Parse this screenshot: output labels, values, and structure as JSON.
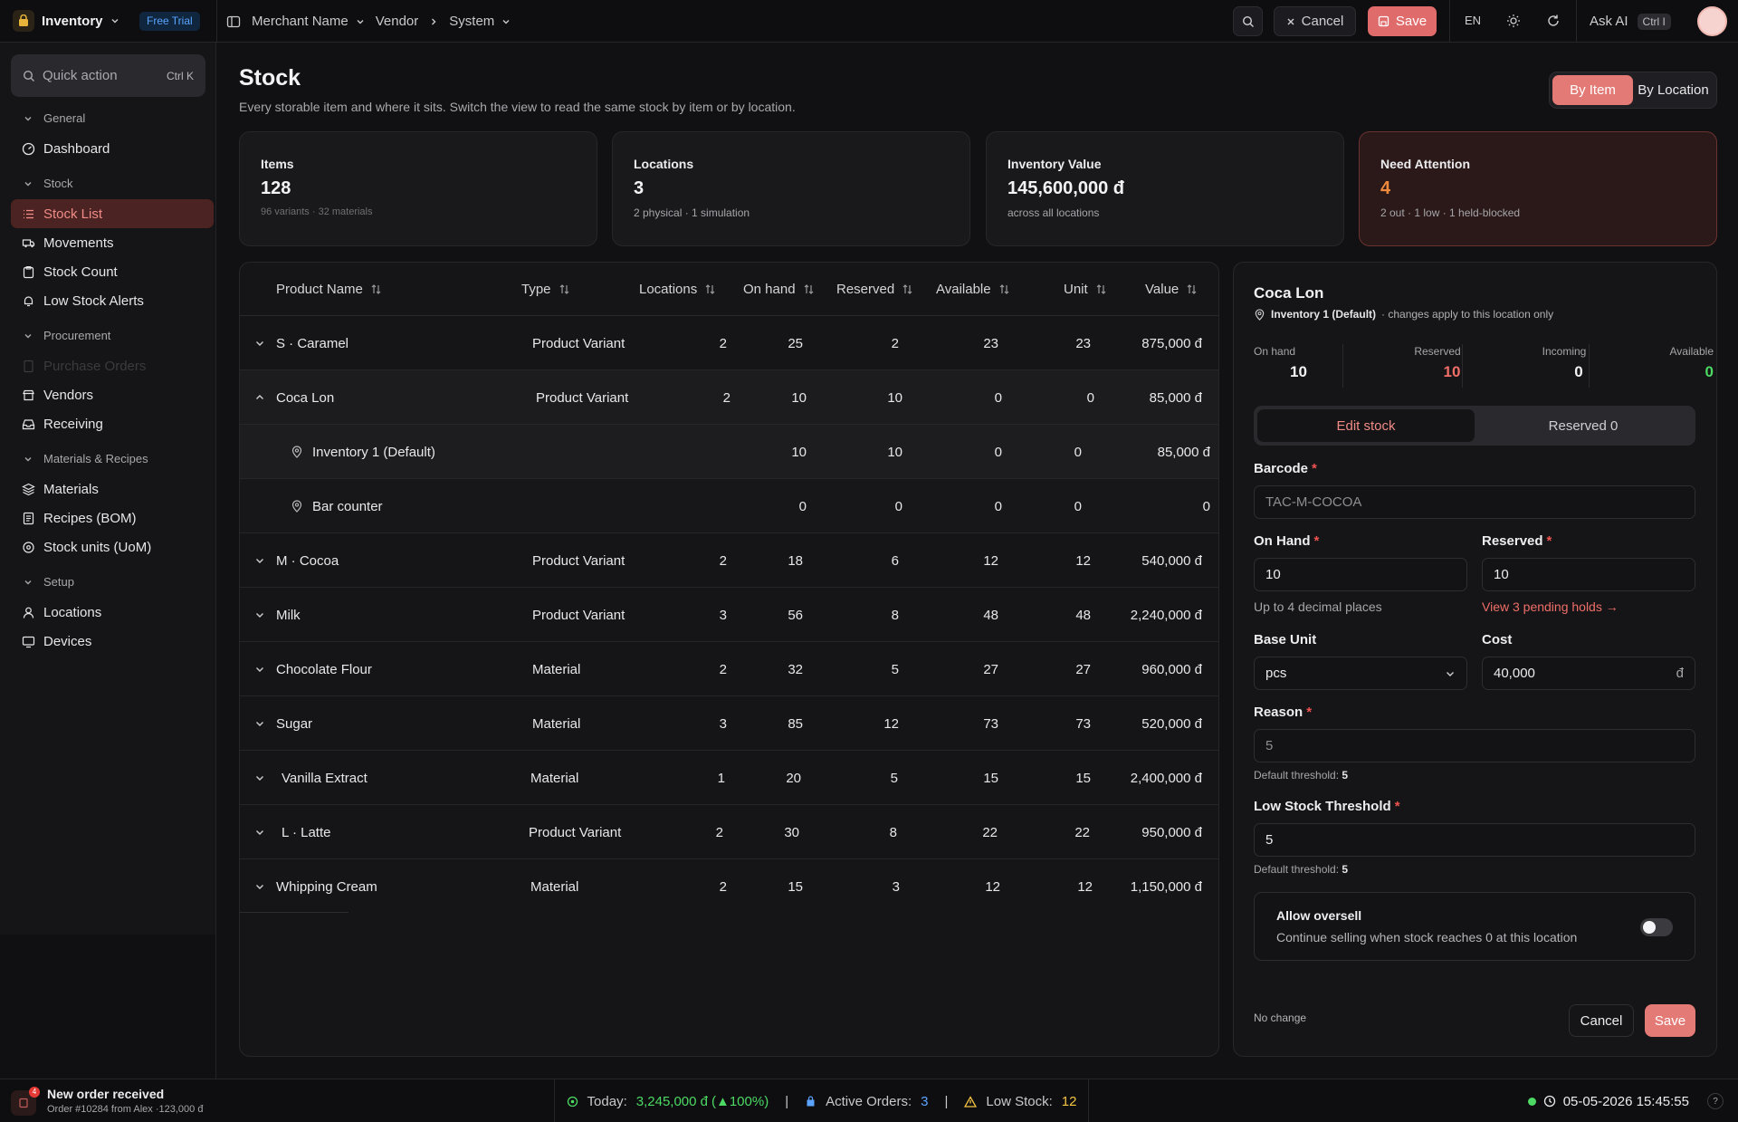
{
  "app": {
    "name": "Inventory",
    "badge": "Free Trial"
  },
  "breadcrumbs": [
    "Merchant Name",
    "Vendor",
    "System"
  ],
  "topbar": {
    "cancel": "Cancel",
    "save": "Save",
    "lang": "EN",
    "ask_ai": "Ask AI",
    "ask_ai_shortcut": "Ctrl I"
  },
  "sidebar": {
    "quick_action": "Quick action",
    "quick_shortcut": "Ctrl K",
    "sections": {
      "general": "General",
      "stock": "Stock",
      "procurement": "Procurement",
      "materials": "Materials & Recipes",
      "setup": "Setup"
    },
    "items": {
      "dashboard": "Dashboard",
      "stock_list": "Stock List",
      "movements": "Movements",
      "stock_count": "Stock Count",
      "low_stock_alerts": "Low Stock Alerts",
      "purchase_orders": "Purchase Orders",
      "vendors": "Vendors",
      "receiving": "Receiving",
      "materials": "Materials",
      "recipes": "Recipes (BOM)",
      "stock_units": "Stock units (UoM)",
      "locations": "Locations",
      "devices": "Devices"
    }
  },
  "page": {
    "title": "Stock",
    "subtitle": "Every storable item and where it sits. Switch the view to read the same stock by item or by location.",
    "view_toggle": [
      "By Item",
      "By Location"
    ],
    "active_view": "By Item"
  },
  "cards": [
    {
      "label": "Items",
      "value": "128",
      "note": "96 variants · 32 materials"
    },
    {
      "label": "Locations",
      "value": "3",
      "note": "2 physical · 1 simulation"
    },
    {
      "label": "Inventory Value",
      "value": "145,600,000 đ",
      "note": "across all locations"
    },
    {
      "label": "Need Attention",
      "value": "4",
      "note": "2 out · 1 low · 1 held-blocked"
    }
  ],
  "table": {
    "columns": [
      "Product Name",
      "Type",
      "Locations",
      "On hand",
      "Reserved",
      "Available",
      "Unit",
      "Value"
    ],
    "rows": [
      {
        "name": "S · Caramel",
        "type": "Product Variant",
        "locations": "2",
        "on_hand": "25",
        "reserved": "2",
        "available": "23",
        "unit": "23",
        "value": "875,000 đ"
      },
      {
        "name": "Coca Lon",
        "type": "Product Variant",
        "locations": "2",
        "on_hand": "10",
        "reserved": "10",
        "available": "0",
        "unit": "0",
        "value": "85,000 đ"
      },
      {
        "name": "M · Cocoa",
        "type": "Product Variant",
        "locations": "2",
        "on_hand": "18",
        "reserved": "6",
        "available": "12",
        "unit": "12",
        "value": "540,000 đ"
      },
      {
        "name": "Milk",
        "type": "Product Variant",
        "locations": "3",
        "on_hand": "56",
        "reserved": "8",
        "available": "48",
        "unit": "48",
        "value": "2,240,000 đ"
      },
      {
        "name": "Chocolate Flour",
        "type": "Material",
        "locations": "2",
        "on_hand": "32",
        "reserved": "5",
        "available": "27",
        "unit": "27",
        "value": "960,000 đ"
      },
      {
        "name": "Sugar",
        "type": "Material",
        "locations": "3",
        "on_hand": "85",
        "reserved": "12",
        "available": "73",
        "unit": "73",
        "value": "520,000 đ"
      },
      {
        "name": "Vanilla Extract",
        "type": "Material",
        "locations": "1",
        "on_hand": "20",
        "reserved": "5",
        "available": "15",
        "unit": "15",
        "value": "2,400,000 đ"
      },
      {
        "name": "L · Latte",
        "type": "Product Variant",
        "locations": "2",
        "on_hand": "30",
        "reserved": "8",
        "available": "22",
        "unit": "22",
        "value": "950,000 đ"
      },
      {
        "name": "Whipping Cream",
        "type": "Material",
        "locations": "2",
        "on_hand": "15",
        "reserved": "3",
        "available": "12",
        "unit": "12",
        "value": "1,150,000 đ"
      }
    ],
    "sub_rows": [
      {
        "name": "Inventory 1 (Default)",
        "on_hand": "10",
        "reserved": "10",
        "available": "0",
        "unit": "0",
        "value": "85,000 đ"
      },
      {
        "name": "Bar counter",
        "on_hand": "0",
        "reserved": "0",
        "available": "0",
        "unit": "0",
        "value": "0"
      }
    ]
  },
  "panel": {
    "title": "Coca Lon",
    "location": "Inventory 1 (Default)",
    "location_note": "· changes apply to this location only",
    "stats": [
      {
        "label": "On hand",
        "value": "10"
      },
      {
        "label": "Reserved",
        "value": "10"
      },
      {
        "label": "Incoming",
        "value": "0"
      },
      {
        "label": "Available",
        "value": "0"
      }
    ],
    "tabs": [
      "Edit stock",
      "Reserved 0"
    ],
    "barcode_label": "Barcode",
    "barcode_value": "TAC-M-COCOA",
    "on_hand_label": "On Hand",
    "on_hand_value": "10",
    "on_hand_hint": "Up to 4 decimal places",
    "reserved_label": "Reserved",
    "reserved_value": "10",
    "reserved_link": "View 3 pending holds →",
    "base_unit_label": "Base Unit",
    "base_unit_value": "pcs",
    "cost_label": "Cost",
    "cost_value": "40,000",
    "cost_unit": "đ",
    "reason_label": "Reason",
    "reason_placeholder": "5",
    "default_threshold_label": "Default threshold:",
    "default_threshold_value": "5",
    "low_label": "Low Stock Threshold",
    "low_value": "5",
    "oversell_title": "Allow oversell",
    "oversell_desc": "Continue selling when stock reaches 0 at this location",
    "oversell_on": false,
    "status": "No change",
    "cancel": "Cancel",
    "save": "Save"
  },
  "statusbar": {
    "notif_title": "New order received",
    "notif_sub": "Order #10284 from Alex ·123,000 đ",
    "notif_count": "4",
    "today_label": "Today:",
    "today_value": "3,245,000 đ",
    "today_delta": "(▲100%)",
    "orders_label": "Active Orders:",
    "orders_value": "3",
    "low_label": "Low Stock:",
    "low_value": "12",
    "datetime": "05-05-2026 15:45:55"
  },
  "colors": {
    "accent": "#e37a75",
    "active_bg": "#4a2322",
    "warn_value": "#ef8a3c",
    "success": "#4cd964",
    "danger": "#ef6e68",
    "info": "#5aa4ff"
  }
}
